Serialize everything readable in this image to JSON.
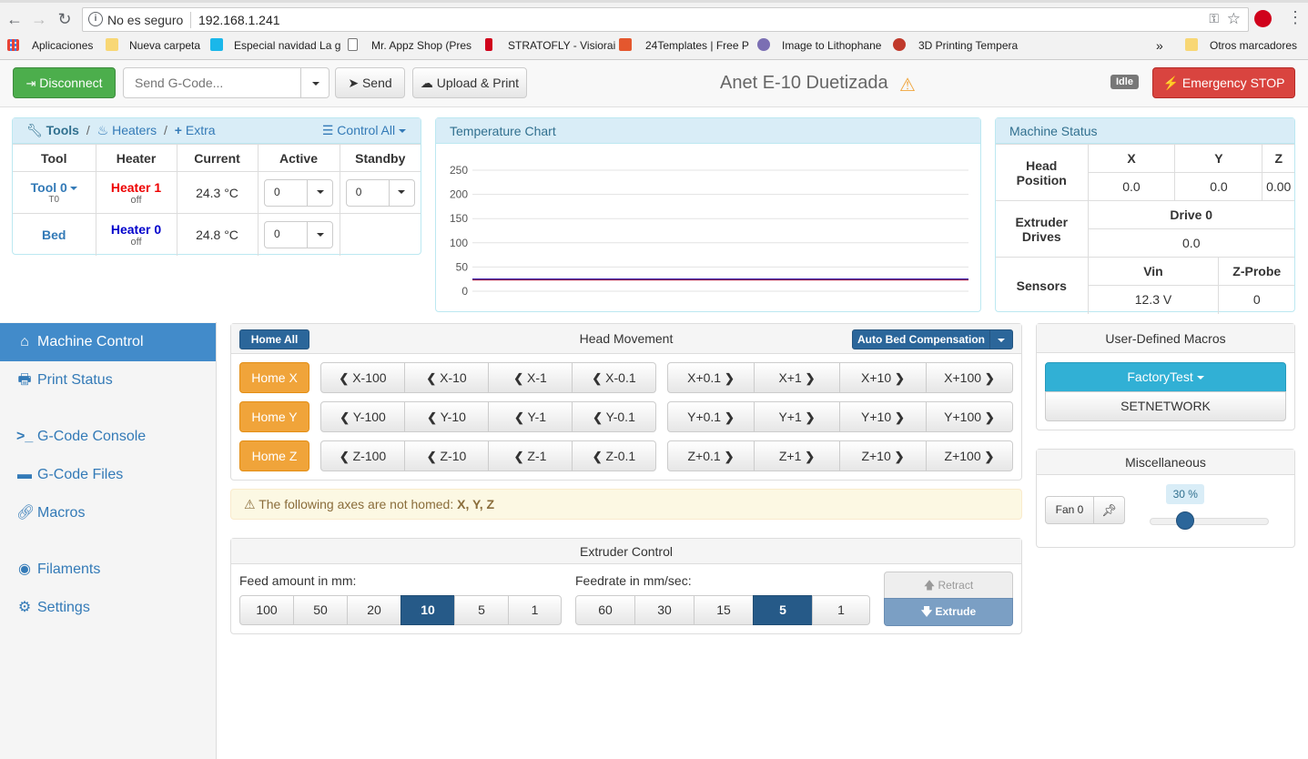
{
  "browser": {
    "security": "No es seguro",
    "url": "192.168.1.241",
    "bookmarks": [
      "Aplicaciones",
      "Nueva carpeta",
      "Especial navidad La g",
      "Mr. Appz Shop (Pres",
      "STRATOFLY - Visiorai",
      "24Templates | Free P",
      "Image to Lithophane",
      "3D Printing Tempera"
    ],
    "more": "»",
    "other_bookmarks": "Otros marcadores"
  },
  "header": {
    "disconnect": "Disconnect",
    "gcode_placeholder": "Send G-Code...",
    "send": "Send",
    "upload_print": "Upload & Print",
    "title": "Anet E-10 Duetizada",
    "status": "Idle",
    "emergency": "Emergency STOP"
  },
  "tools": {
    "tab_tools": "Tools",
    "tab_heaters": "Heaters",
    "tab_extra": "Extra",
    "sep": "/",
    "control_all": "Control All",
    "columns": [
      "Tool",
      "Heater",
      "Current",
      "Active",
      "Standby"
    ],
    "rows": [
      {
        "tool": "Tool 0",
        "tool_sub": "T0",
        "heater": "Heater 1",
        "heater_state": "off",
        "current": "24.3 °C",
        "active": "0",
        "standby": "0"
      },
      {
        "tool": "Bed",
        "tool_sub": "",
        "heater": "Heater 0",
        "heater_state": "off",
        "current": "24.8 °C",
        "active": "0"
      }
    ]
  },
  "temperature_chart": {
    "title": "Temperature Chart"
  },
  "chart_data": {
    "type": "line",
    "title": "",
    "ylim": [
      0,
      250
    ],
    "y_ticks": [
      "250",
      "200",
      "150",
      "100",
      "50",
      "0"
    ],
    "series": [
      {
        "color": "#dd0000",
        "values": [
          24.3,
          24.3,
          24.3,
          24.3,
          24.3
        ]
      },
      {
        "color": "#0000cc",
        "values": [
          24.8,
          24.8,
          24.8,
          24.8,
          24.8
        ]
      }
    ]
  },
  "machine_status": {
    "title": "Machine Status",
    "head_position_label": "Head Position",
    "axes": [
      "X",
      "Y",
      "Z"
    ],
    "axis_values": [
      "0.0",
      "0.0",
      "0.00"
    ],
    "extruder_label": "Extruder Drives",
    "drive_label": "Drive 0",
    "drive_value": "0.0",
    "sensors_label": "Sensors",
    "vin_label": "Vin",
    "vin_value": "12.3 V",
    "zprobe_label": "Z-Probe",
    "zprobe_value": "0"
  },
  "sidebar": {
    "items": [
      {
        "label": "Machine Control",
        "icon": "home-icon"
      },
      {
        "label": "Print Status",
        "icon": "printer-icon"
      },
      {
        "label": "G-Code Console",
        "icon": "terminal-icon"
      },
      {
        "label": "G-Code Files",
        "icon": "hdd-icon"
      },
      {
        "label": "Macros",
        "icon": "link-icon"
      },
      {
        "label": "Filaments",
        "icon": "cd-icon"
      },
      {
        "label": "Settings",
        "icon": "gear-icon"
      }
    ]
  },
  "head_movement": {
    "title": "Head Movement",
    "home_all": "Home All",
    "auto_bed": "Auto Bed Compensation",
    "rows": [
      {
        "home": "Home X",
        "neg": [
          "X-100",
          "X-10",
          "X-1",
          "X-0.1"
        ],
        "pos": [
          "X+0.1",
          "X+1",
          "X+10",
          "X+100"
        ]
      },
      {
        "home": "Home Y",
        "neg": [
          "Y-100",
          "Y-10",
          "Y-1",
          "Y-0.1"
        ],
        "pos": [
          "Y+0.1",
          "Y+1",
          "Y+10",
          "Y+100"
        ]
      },
      {
        "home": "Home Z",
        "neg": [
          "Z-100",
          "Z-10",
          "Z-1",
          "Z-0.1"
        ],
        "pos": [
          "Z+0.1",
          "Z+1",
          "Z+10",
          "Z+100"
        ]
      }
    ]
  },
  "alert": {
    "text": "The following axes are not homed:",
    "axes": "X, Y, Z"
  },
  "extruder": {
    "title": "Extruder Control",
    "feed_label": "Feed amount in mm:",
    "feed_options": [
      "100",
      "50",
      "20",
      "10",
      "5",
      "1"
    ],
    "feed_selected": "10",
    "rate_label": "Feedrate in mm/sec:",
    "rate_options": [
      "60",
      "30",
      "15",
      "5",
      "1"
    ],
    "rate_selected": "5",
    "retract": "Retract",
    "extrude": "Extrude"
  },
  "macros": {
    "title": "User-Defined Macros",
    "items": [
      "FactoryTest",
      "SETNETWORK"
    ]
  },
  "misc": {
    "title": "Miscellaneous",
    "fan": "Fan 0",
    "fan_percent": "30 %",
    "fan_value": 30
  }
}
